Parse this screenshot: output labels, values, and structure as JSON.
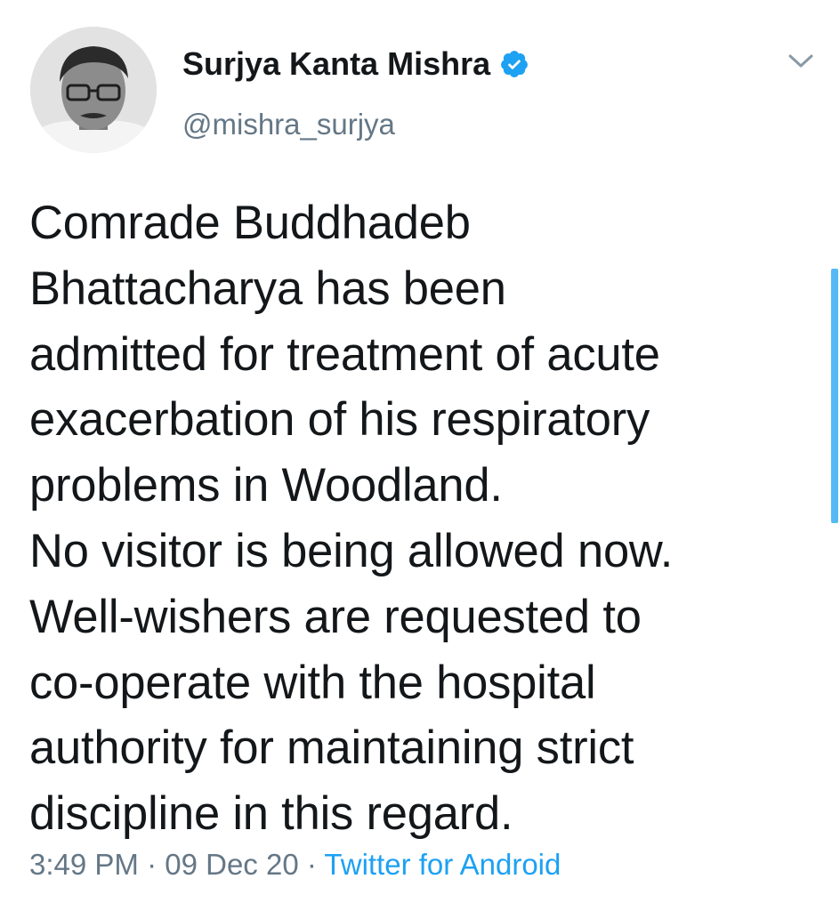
{
  "tweet": {
    "author": {
      "display_name": "Surjya Kanta Mishra",
      "handle": "@mishra_surjya",
      "verified": true
    },
    "text": "Comrade Buddhadeb\nBhattacharya has been\nadmitted for treatment of acute\nexacerbation of his respiratory\nproblems in Woodland.\nNo visitor is being allowed now.\nWell-wishers are requested to\nco-operate with the hospital\nauthority for maintaining strict\ndiscipline in this regard.",
    "time": "3:49 PM",
    "date": "09 Dec 20",
    "separator": " · ",
    "source": "Twitter for Android"
  },
  "icons": {
    "verified": "verified-badge-icon",
    "menu": "chevron-down-icon"
  },
  "colors": {
    "text": "#14171a",
    "secondary": "#657786",
    "accent": "#1da1f2"
  }
}
